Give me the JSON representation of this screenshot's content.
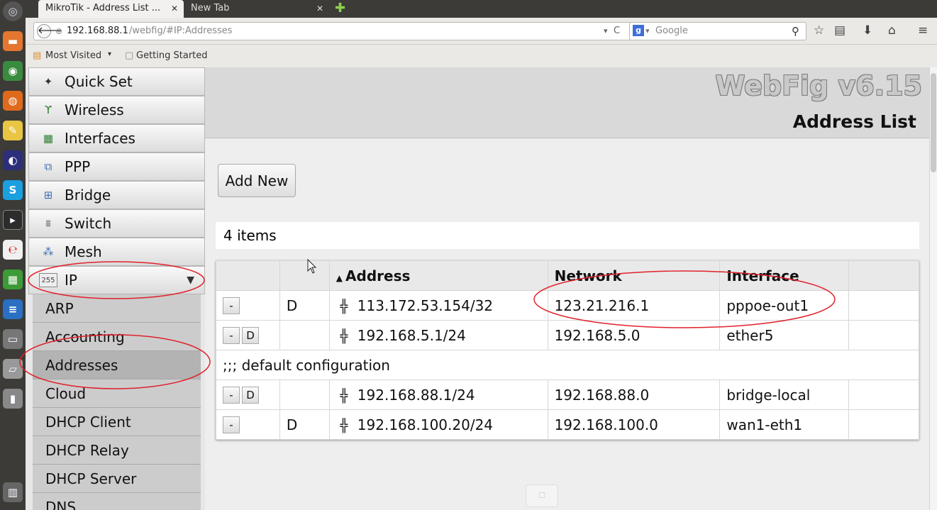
{
  "browser": {
    "tabs": [
      {
        "title": "MikroTik - Address List ..."
      },
      {
        "title": "New Tab"
      }
    ],
    "url": {
      "host": "192.168.88.1",
      "path": "/webfig/#IP:Addresses"
    },
    "search": {
      "placeholder": "Google"
    },
    "bookmarks": [
      "Most Visited",
      "Getting Started"
    ]
  },
  "sidebar": {
    "items": [
      {
        "label": "Quick Set",
        "icon": "quick-set-icon"
      },
      {
        "label": "Wireless",
        "icon": "wireless-icon"
      },
      {
        "label": "Interfaces",
        "icon": "interfaces-icon"
      },
      {
        "label": "PPP",
        "icon": "ppp-icon"
      },
      {
        "label": "Bridge",
        "icon": "bridge-icon"
      },
      {
        "label": "Switch",
        "icon": "switch-icon"
      },
      {
        "label": "Mesh",
        "icon": "mesh-icon"
      },
      {
        "label": "IP",
        "icon": "ip-icon",
        "expanded": true
      }
    ],
    "ip_submenu": [
      "ARP",
      "Accounting",
      "Addresses",
      "Cloud",
      "DHCP Client",
      "DHCP Relay",
      "DHCP Server",
      "DNS"
    ],
    "active_submenu": "Addresses"
  },
  "header": {
    "brand": "WebFig v6.15",
    "page_title": "Address List"
  },
  "toolbar": {
    "add_new_label": "Add New"
  },
  "list": {
    "count_label": "4 items",
    "columns": [
      "Address",
      "Network",
      "Interface"
    ],
    "sort_indicator": "▲",
    "rows": [
      {
        "remove": "-",
        "disable": "",
        "flag": "D",
        "address": "113.172.53.154/32",
        "network": "123.21.216.1",
        "interface": "pppoe-out1"
      },
      {
        "remove": "-",
        "disable": "D",
        "flag": "",
        "address": "192.168.5.1/24",
        "network": "192.168.5.0",
        "interface": "ether5"
      },
      {
        "comment": ";;; default configuration"
      },
      {
        "remove": "-",
        "disable": "D",
        "flag": "",
        "address": "192.168.88.1/24",
        "network": "192.168.88.0",
        "interface": "bridge-local"
      },
      {
        "remove": "-",
        "disable": "",
        "flag": "D",
        "address": "192.168.100.20/24",
        "network": "192.168.100.0",
        "interface": "wan1-eth1"
      }
    ]
  },
  "annotation_color": "#e0212a"
}
